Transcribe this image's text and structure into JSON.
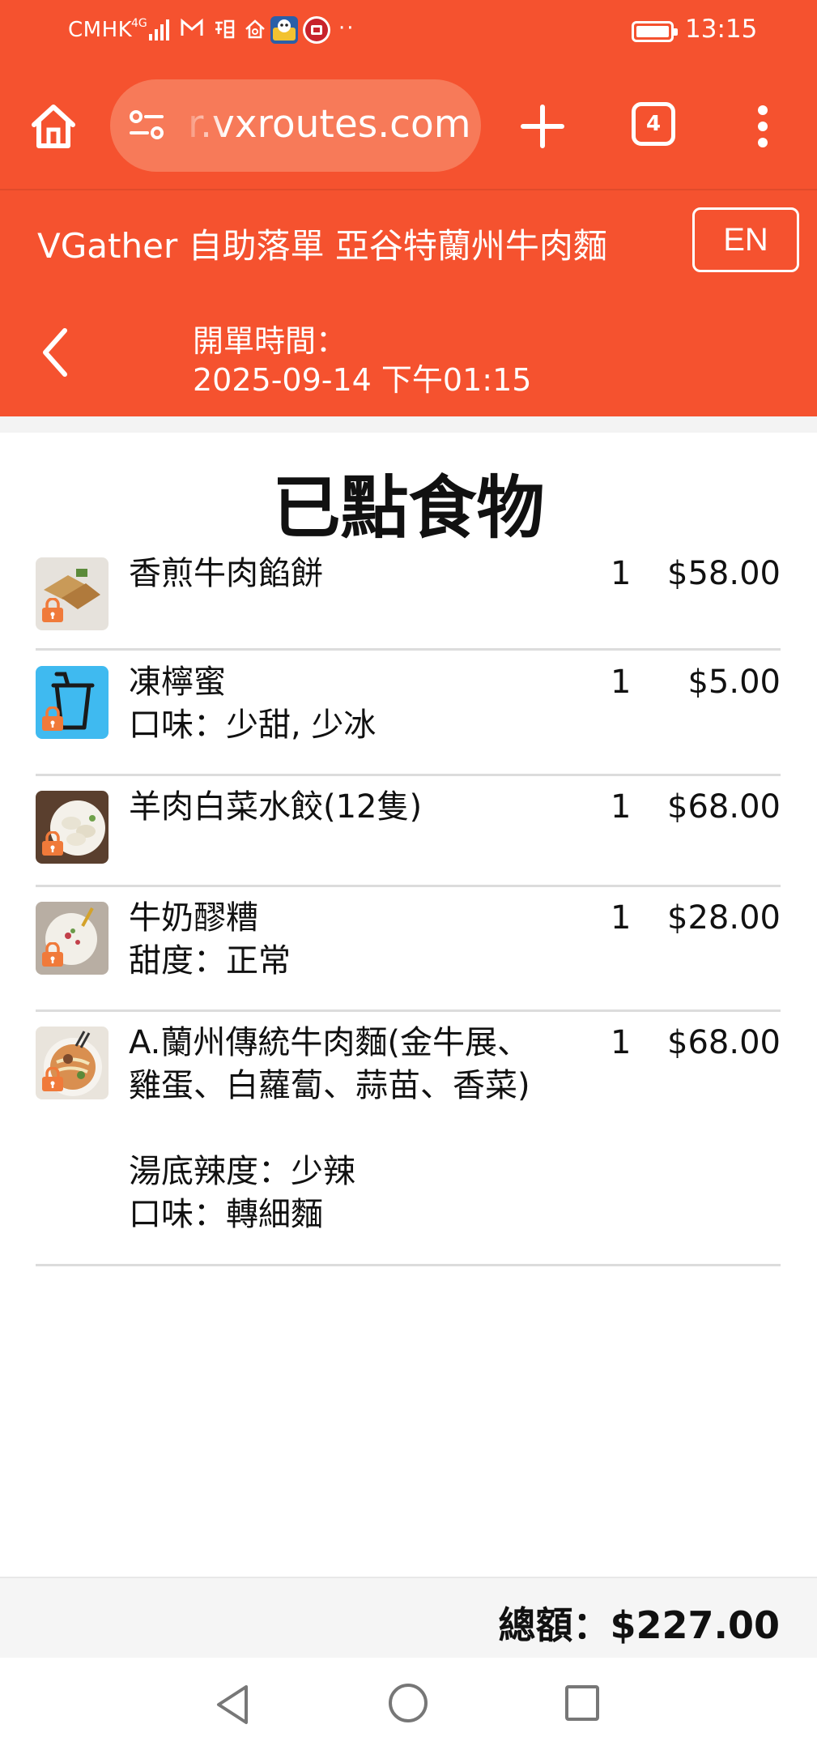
{
  "status_bar": {
    "carrier": "CMHK",
    "network": "4G",
    "time": "13:15",
    "icons": [
      "signal-icon",
      "mail-icon",
      "taobao-icon",
      "home-app-icon",
      "sticker-app-icon",
      "red-app-icon",
      "more-dots-icon",
      "battery-icon"
    ]
  },
  "browser": {
    "url": "r.vxroutes.com",
    "tab_count": "4",
    "icons": [
      "home-icon",
      "site-settings-icon",
      "new-tab-plus-icon",
      "tab-switcher-icon",
      "menu-kebab-icon"
    ]
  },
  "header": {
    "store_title": "VGather 自助落單 亞谷特蘭州牛肉麵",
    "lang_button": "EN",
    "open_time_label": "開單時間：",
    "open_time_value": "2025-09-14 下午01:15"
  },
  "order": {
    "title": "已點食物",
    "items": [
      {
        "name": "香煎牛肉餡餅",
        "options": [],
        "qty": "1",
        "price": "$58.00"
      },
      {
        "name": "凍檸蜜",
        "options": [
          "口味：少甜, 少冰"
        ],
        "qty": "1",
        "price": "$5.00"
      },
      {
        "name": "羊肉白菜水餃(12隻)",
        "options": [],
        "qty": "1",
        "price": "$68.00"
      },
      {
        "name": "牛奶醪糟",
        "options": [
          "甜度：正常"
        ],
        "qty": "1",
        "price": "$28.00"
      },
      {
        "name": "A.蘭州傳統牛肉麵(金牛展、雞蛋、白蘿蔔、蒜苗、香菜)",
        "options": [
          "湯底辣度：少辣",
          "口味：轉細麵"
        ],
        "qty": "1",
        "price": "$68.00"
      }
    ]
  },
  "total": {
    "text": "總額：$227.00"
  },
  "colors": {
    "header_bg": "#f5522f",
    "url_pill": "#f77a59",
    "lock_badge": "#f07a3a",
    "divider": "#dcdcdc"
  }
}
